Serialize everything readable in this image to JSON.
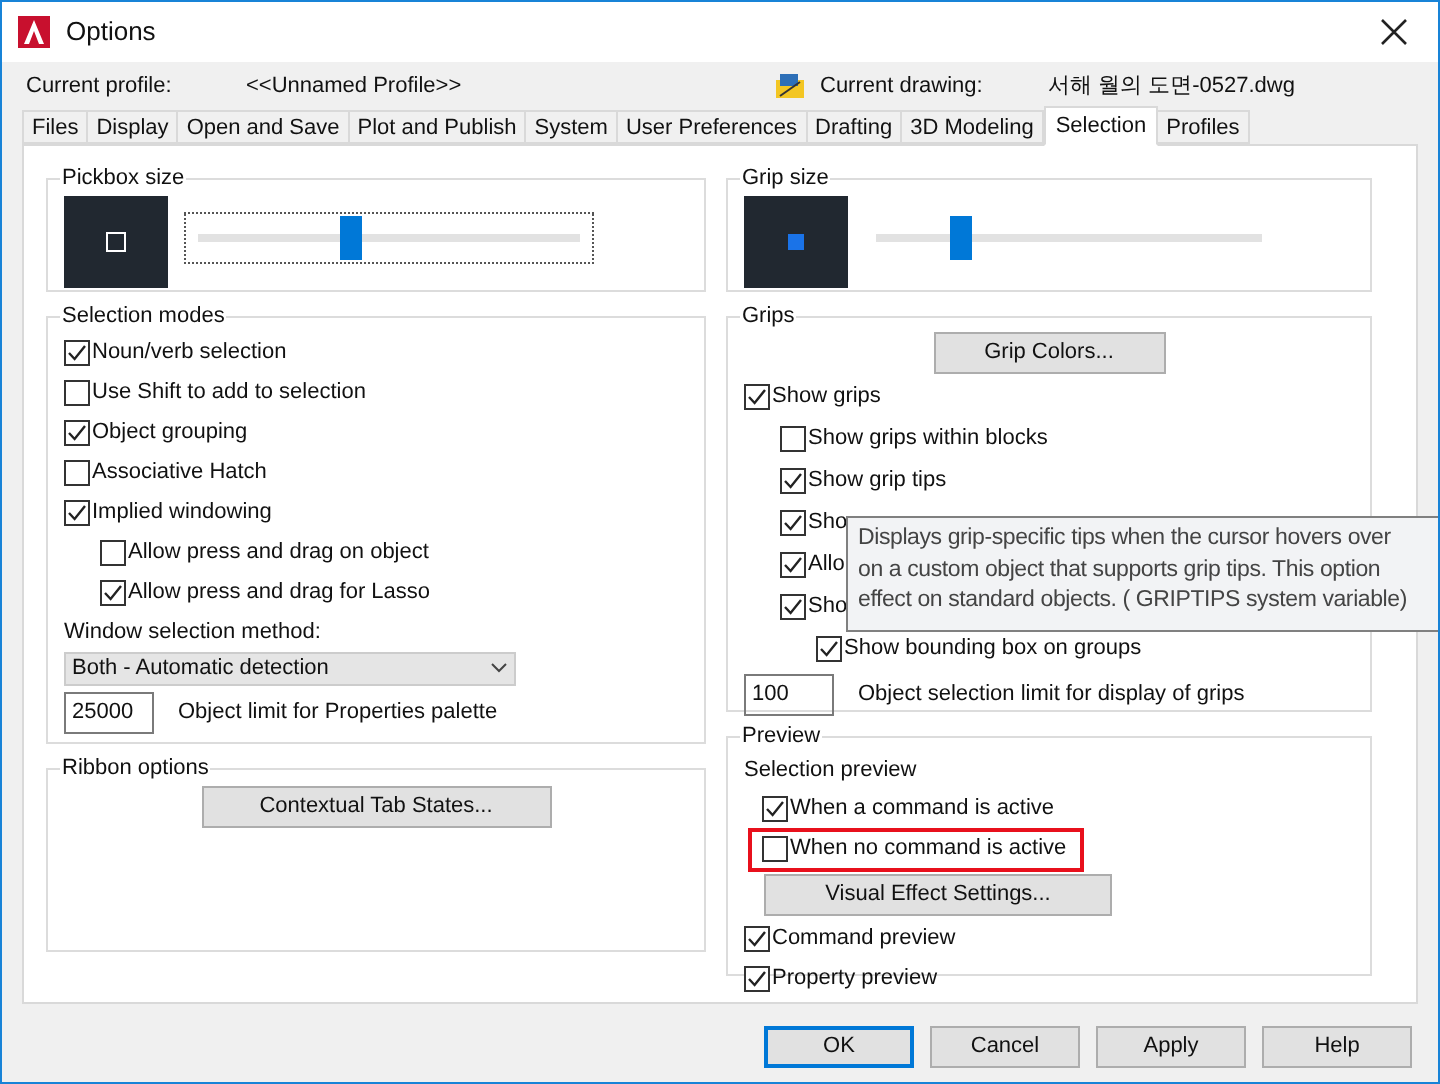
{
  "window": {
    "title": "Options"
  },
  "current_profile": {
    "label": "Current profile:",
    "value": "<<Unnamed Profile>>"
  },
  "current_drawing": {
    "label": "Current drawing:",
    "value": "서해 월의 도면-0527.dwg"
  },
  "tabs": [
    {
      "label": "Files",
      "selected": false
    },
    {
      "label": "Display",
      "selected": false
    },
    {
      "label": "Open and Save",
      "selected": false
    },
    {
      "label": "Plot and Publish",
      "selected": false
    },
    {
      "label": "System",
      "selected": false
    },
    {
      "label": "User Preferences",
      "selected": false
    },
    {
      "label": "Drafting",
      "selected": false
    },
    {
      "label": "3D Modeling",
      "selected": false
    },
    {
      "label": "Selection",
      "selected": true
    },
    {
      "label": "Profiles",
      "selected": false
    }
  ],
  "pickbox": {
    "title": "Pickbox size",
    "level": 0.4
  },
  "selection_modes": {
    "title": "Selection modes",
    "items": [
      {
        "label": "Noun/verb selection",
        "checked": true
      },
      {
        "label": "Use Shift to add to selection",
        "checked": false
      },
      {
        "label": "Object grouping",
        "checked": true
      },
      {
        "label": "Associative Hatch",
        "checked": false
      },
      {
        "label": "Implied windowing",
        "checked": true,
        "children": [
          {
            "label": "Allow press and drag on object",
            "checked": false
          },
          {
            "label": "Allow press and drag for Lasso",
            "checked": true
          }
        ]
      }
    ],
    "window_selection_method": {
      "label": "Window selection method:",
      "value": "Both - Automatic detection"
    },
    "object_limit": {
      "value": "25000",
      "label": "Object limit for Properties palette"
    }
  },
  "ribbon_options": {
    "title": "Ribbon options",
    "button": "Contextual Tab States..."
  },
  "grip_size": {
    "title": "Grip size",
    "level": 0.22
  },
  "grips": {
    "title": "Grips",
    "button": "Grip Colors...",
    "items": [
      {
        "label": "Show grips",
        "checked": true,
        "children": [
          {
            "label": "Show grips within blocks",
            "checked": false
          },
          {
            "label": "Show grip tips",
            "checked": true
          },
          {
            "label": "Sho",
            "checked": true
          },
          {
            "label": "Allo",
            "checked": true
          },
          {
            "label": "Sho",
            "checked": true,
            "children": [
              {
                "label": "Show bounding box on groups",
                "checked": true
              }
            ]
          }
        ]
      }
    ],
    "limit": {
      "value": "100",
      "label": "Object selection limit for display of grips"
    }
  },
  "tooltip": {
    "text": "Displays grip-specific tips when the cursor hovers over\non a custom object that supports grip tips. This option\neffect on standard objects. ( GRIPTIPS system variable)"
  },
  "preview": {
    "title": "Preview",
    "selection_preview": {
      "title": "Selection preview",
      "items": [
        {
          "label": "When a command is active",
          "checked": true,
          "highlighted": false
        },
        {
          "label": "When no command is active",
          "checked": false,
          "highlighted": true
        }
      ],
      "button": "Visual Effect Settings..."
    },
    "items": [
      {
        "label": "Command preview",
        "checked": true
      },
      {
        "label": "Property preview",
        "checked": true
      }
    ]
  },
  "buttons": [
    {
      "label": "OK",
      "default": true
    },
    {
      "label": "Cancel",
      "default": false
    },
    {
      "label": "Apply",
      "default": false
    },
    {
      "label": "Help",
      "default": false
    }
  ]
}
